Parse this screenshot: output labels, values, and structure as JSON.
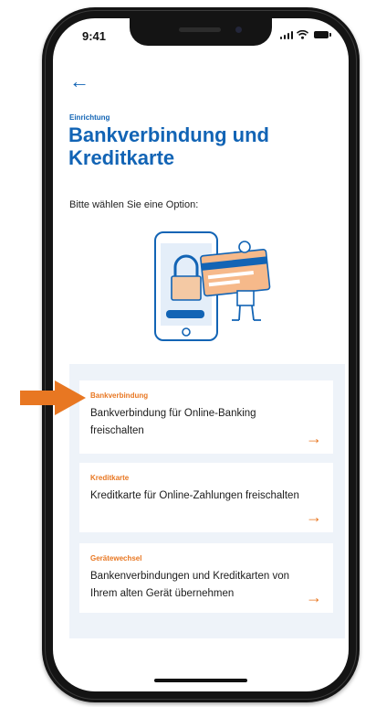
{
  "status_bar": {
    "time": "9:41"
  },
  "header": {
    "kicker": "Einrichtung",
    "title": "Bankverbindung und Kreditkarte"
  },
  "intro": "Bitte wählen Sie eine Option:",
  "options": [
    {
      "label": "Bankverbindung",
      "text": "Bankverbindung für Online-Banking freischalten",
      "arrow": "→"
    },
    {
      "label": "Kreditkarte",
      "text": "Kreditkarte für Online-Zahlungen freischalten",
      "arrow": "→"
    },
    {
      "label": "Gerätewechsel",
      "text": "Bankenverbindungen und Kreditkarten von Ihrem alten Gerät übernehmen",
      "arrow": "→"
    }
  ],
  "colors": {
    "primary": "#1264b5",
    "accent": "#e87722",
    "panel": "#eef3f9"
  },
  "icons": {
    "back": "arrow-left-icon",
    "illustration": "phone-lock-card-illustration",
    "pointer": "orange-arrow-pointer"
  }
}
